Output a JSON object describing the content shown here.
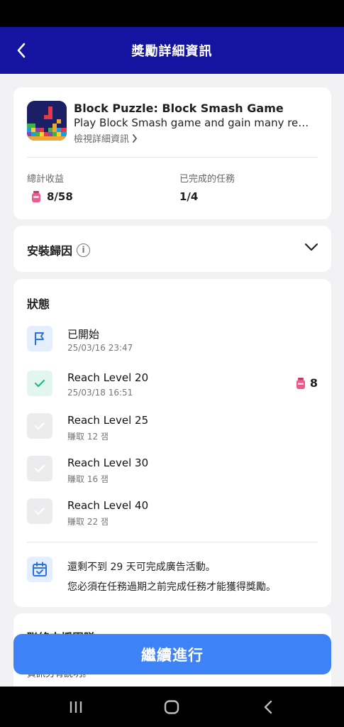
{
  "header": {
    "title": "獎勵詳細資訊"
  },
  "app": {
    "name": "Block Puzzle: Block Smash Game",
    "description": "Play Block Smash game and gain many rewards",
    "details_link": "檢視詳細資訊"
  },
  "stats": {
    "earnings_label": "總計收益",
    "earnings_value": "8/58",
    "tasks_label": "已完成的任務",
    "tasks_value": "1/4"
  },
  "attribution": {
    "title": "安裝歸因",
    "info_glyph": "i"
  },
  "status": {
    "title": "狀態",
    "tasks": [
      {
        "name": "已開始",
        "sub": "25/03/16 23:47",
        "state": "started",
        "icon": "flag-icon"
      },
      {
        "name": "Reach Level 20",
        "sub": "25/03/18 16:51",
        "state": "done",
        "reward": "8",
        "icon": "check-icon"
      },
      {
        "name": "Reach Level 25",
        "sub": "賺取 12 잼",
        "state": "pending",
        "icon": "check-icon"
      },
      {
        "name": "Reach Level 30",
        "sub": "賺取 16 잼",
        "state": "pending",
        "icon": "check-icon"
      },
      {
        "name": "Reach Level 40",
        "sub": "賺取 22 잼",
        "state": "pending",
        "icon": "check-icon"
      }
    ],
    "notice_line1": "還剩不到 29 天可完成廣告活動。",
    "notice_line2": "您必須在任務過期之前完成任務才能獲得獎勵。"
  },
  "support": {
    "title": "聯絡支援團隊",
    "text": "如果您有任何問題，請與我們的客服團隊聯絡，我們會提供協助。詳細資訊另有說明。"
  },
  "cta": {
    "label": "繼續進行"
  },
  "colors": {
    "header": "#1414a0",
    "accent": "#3d82f6",
    "success": "#1fb88a",
    "jam": "#ef5a8d"
  }
}
